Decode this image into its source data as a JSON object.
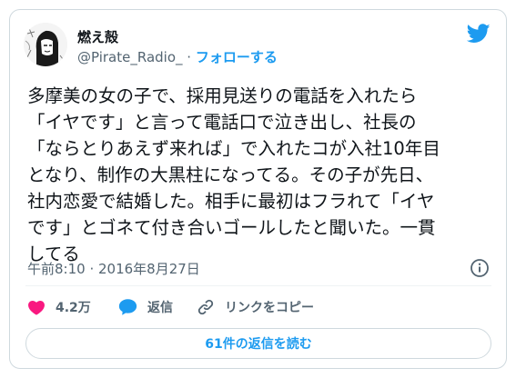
{
  "author": {
    "display_name": "燃え殻",
    "handle": "@Pirate_Radio_",
    "separator": "·",
    "follow_label": "フォローする",
    "avatar_icon": "avatar-drawing-icon"
  },
  "tweet": {
    "text": "多摩美の女の子で、採用見送りの電話を入れたら\n「イヤです」と言って電話口で泣き出し、社長の\n「ならとりあえず来れば」で入れたコが入社10年目\nとなり、制作の大黒柱になってる。その子が先日、\n社内恋愛で結婚した。相手に最初はフラれて「イヤ\nです」とゴネて付き合いゴールしたと聞いた。一貫\nしてる",
    "timestamp": "午前8:10 · 2016年8月27日"
  },
  "actions": {
    "like_count": "4.2万",
    "reply_label": "返信",
    "copy_link_label": "リンクをコピー"
  },
  "footer": {
    "read_replies_label": "61件の返信を読む"
  },
  "colors": {
    "accent": "#1d9bf0",
    "like": "#f91880",
    "muted": "#536471",
    "border": "#cfd9de"
  }
}
